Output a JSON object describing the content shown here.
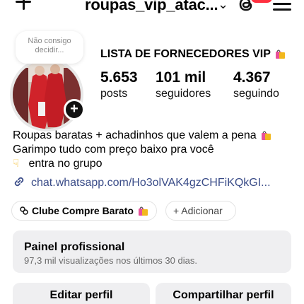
{
  "header": {
    "username": "roupas_vip_atac...",
    "icons": [
      "plus-icon",
      "chevron-down-icon",
      "threads-icon",
      "menu-icon"
    ],
    "badge_color": "#ff3040"
  },
  "note": {
    "line1": "Não consigo",
    "line2": "decidir..."
  },
  "profile": {
    "display_name": "LISTA DE FORNECEDORES VIP",
    "stats": [
      {
        "value": "5.653",
        "label": "posts"
      },
      {
        "value": "101 mil",
        "label": "seguidores"
      },
      {
        "value": "4.367",
        "label": "seguindo"
      }
    ]
  },
  "bio": {
    "line1": "Roupas baratas + achadinhos que valem a pena",
    "line2": "Garimpo tudo com preço baixo pra você",
    "line3": "entra no grupo",
    "link": "chat.whatsapp.com/Ho3olVAK4gzCHFiKQkGI..."
  },
  "chips": {
    "community": "Clube Compre Barato",
    "add": "+ Adicionar"
  },
  "professional_panel": {
    "title": "Painel profissional",
    "subtitle": "97,3 mil visualizações nos últimos 30 dias."
  },
  "actions": {
    "edit": "Editar perfil",
    "share": "Compartilhar perfil"
  },
  "colors": {
    "link": "#3a4c88",
    "panel_bg": "#efeff1",
    "bag_pink": "#e8509a"
  }
}
